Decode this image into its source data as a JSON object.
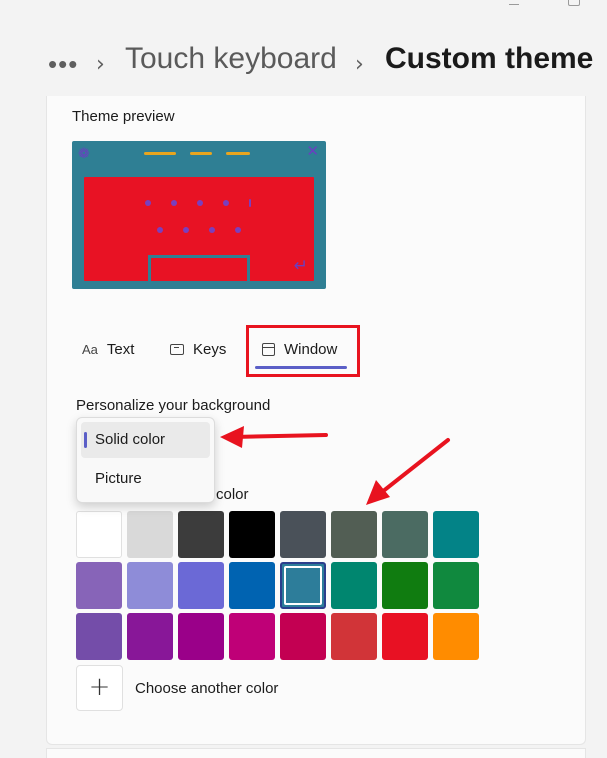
{
  "breadcrumb": {
    "more": "•••",
    "separator": "›",
    "parent": "Touch keyboard",
    "current": "Custom theme"
  },
  "preview": {
    "label": "Theme preview",
    "colors": {
      "window": "#2f7f94",
      "keys": "#e81224",
      "accent": "#e8a51f",
      "text": "#7a3fbf"
    }
  },
  "tabs": [
    {
      "icon": "Aa",
      "label": "Text"
    },
    {
      "icon": "keys-icon",
      "label": "Keys"
    },
    {
      "icon": "window-icon",
      "label": "Window",
      "selected": true
    }
  ],
  "background": {
    "label": "Personalize your background",
    "dropdown": {
      "options": [
        "Solid color",
        "Picture"
      ],
      "selected": "Solid color"
    },
    "color_label_partial": "color",
    "swatches": [
      [
        "#ffffff",
        "#d9d9d9",
        "#3c3c3c",
        "#000000",
        "#4a5159",
        "#525e54",
        "#4b6b62",
        "#038387"
      ],
      [
        "#8764b8",
        "#8e8cd8",
        "#6b69d6",
        "#0063b1",
        "#2d7d9a",
        "#00866f",
        "#107c10",
        "#10893e"
      ],
      [
        "#744da9",
        "#881798",
        "#9a0089",
        "#bf0077",
        "#c30052",
        "#d13438",
        "#e81123",
        "#ff8c00"
      ]
    ],
    "selected_swatch": [
      1,
      4
    ],
    "add_button": "+",
    "add_label": "Choose another color"
  },
  "annotation_color": "#e8131f"
}
